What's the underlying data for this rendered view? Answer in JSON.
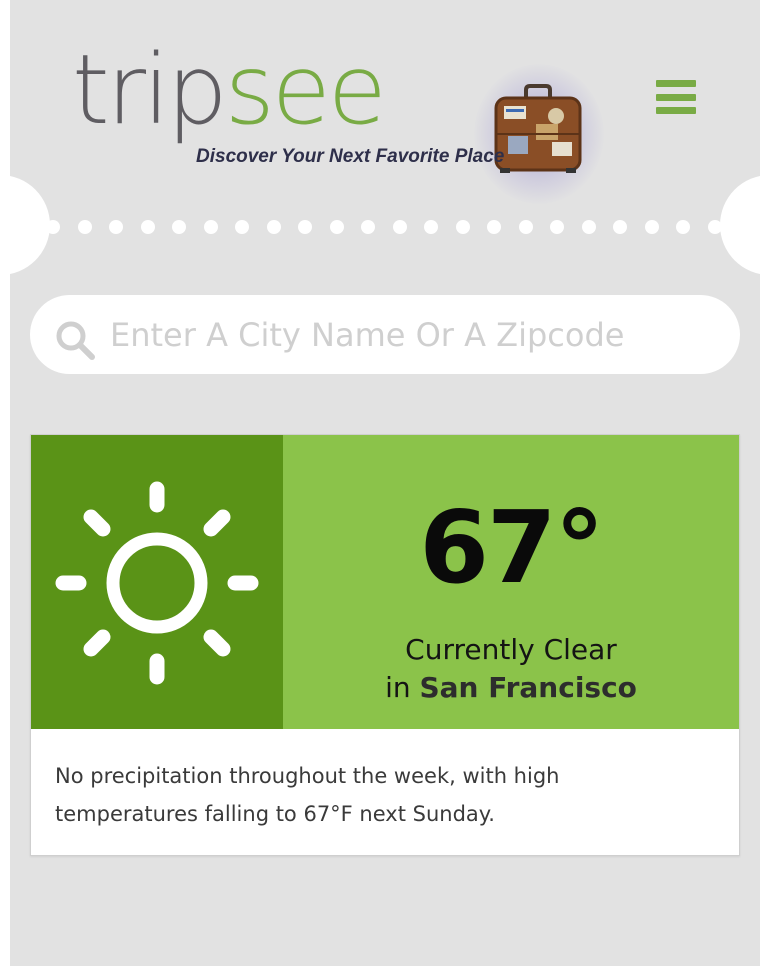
{
  "header": {
    "logo_part1": "trip",
    "logo_part2": "see",
    "tagline": "Discover Your Next Favorite Place",
    "suitcase_icon": "suitcase-icon",
    "menu_icon": "hamburger-menu-icon"
  },
  "search": {
    "icon": "search-icon",
    "placeholder": "Enter A City Name Or A Zipcode",
    "value": ""
  },
  "weather": {
    "icon": "sun-icon",
    "temperature": "67°",
    "condition": "Currently Clear",
    "location_prefix": "in",
    "city": "San Francisco",
    "summary": "No precipitation throughout the week, with high temperatures falling to 67°F next Sunday."
  },
  "colors": {
    "brand_green": "#79ab45",
    "brand_gray": "#5f5d62",
    "icon_panel_green": "#5a9317",
    "info_panel_green": "#8bc34a",
    "page_background": "#e2e2e2"
  }
}
